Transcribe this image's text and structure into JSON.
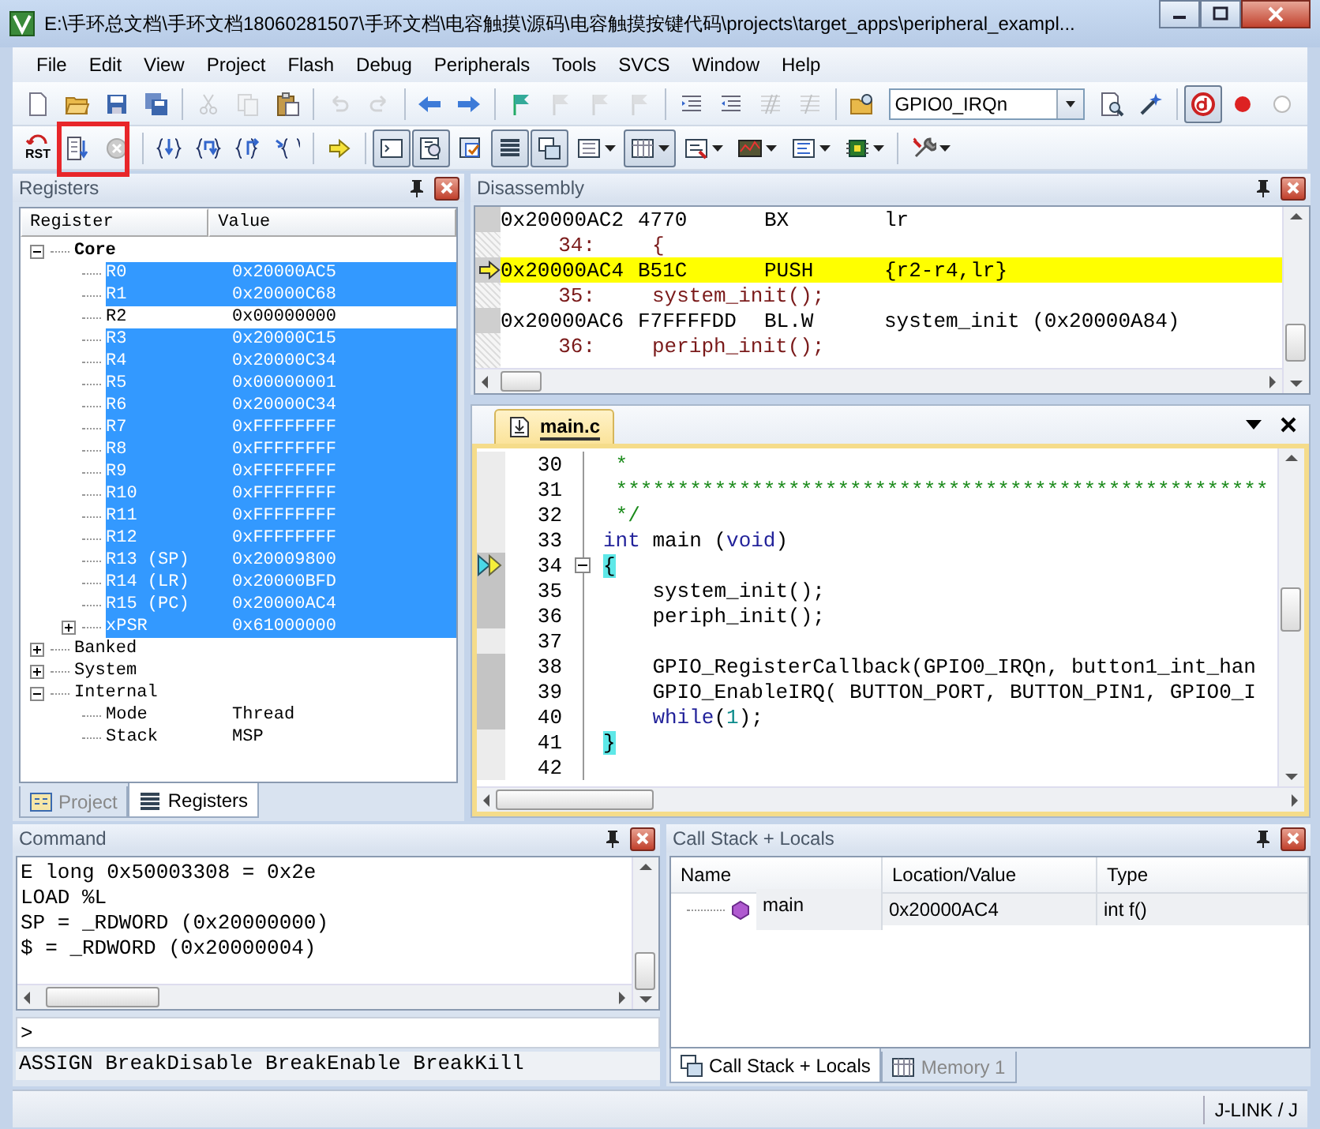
{
  "window": {
    "title": "E:\\手环总文档\\手环文档18060281507\\手环文档\\电容触摸\\源码\\电容触摸按键代码\\projects\\target_apps\\peripheral_exampl..."
  },
  "menu": [
    "File",
    "Edit",
    "View",
    "Project",
    "Flash",
    "Debug",
    "Peripherals",
    "Tools",
    "SVCS",
    "Window",
    "Help"
  ],
  "toolbar": [
    {
      "kind": "new",
      "pressed": false,
      "disabled": false
    },
    {
      "kind": "open",
      "pressed": false,
      "disabled": false
    },
    {
      "kind": "save",
      "pressed": false,
      "disabled": false
    },
    {
      "kind": "save_all",
      "pressed": false,
      "disabled": false
    },
    {
      "kind": "separator"
    },
    {
      "kind": "cut",
      "pressed": false,
      "disabled": true
    },
    {
      "kind": "copy",
      "pressed": false,
      "disabled": true
    },
    {
      "kind": "paste",
      "pressed": false,
      "disabled": false
    },
    {
      "kind": "separator"
    },
    {
      "kind": "undo",
      "pressed": false,
      "disabled": true
    },
    {
      "kind": "redo",
      "pressed": false,
      "disabled": true
    },
    {
      "kind": "separator"
    },
    {
      "kind": "back",
      "pressed": false,
      "disabled": false
    },
    {
      "kind": "forward",
      "pressed": false,
      "disabled": false
    },
    {
      "kind": "separator"
    },
    {
      "kind": "bookmark_set",
      "pressed": false,
      "disabled": false
    },
    {
      "kind": "bookmark_prev",
      "pressed": false,
      "disabled": true
    },
    {
      "kind": "bookmark_next",
      "pressed": false,
      "disabled": true
    },
    {
      "kind": "bookmark_clear",
      "pressed": false,
      "disabled": true
    },
    {
      "kind": "separator"
    },
    {
      "kind": "indent",
      "pressed": false,
      "disabled": false
    },
    {
      "kind": "unindent",
      "pressed": false,
      "disabled": false
    },
    {
      "kind": "comment",
      "pressed": false,
      "disabled": true
    },
    {
      "kind": "uncomment",
      "pressed": false,
      "disabled": true
    },
    {
      "kind": "separator"
    },
    {
      "kind": "find_in_files",
      "pressed": false,
      "disabled": false
    },
    {
      "kind": "combo",
      "value": "GPIO0_IRQn"
    },
    {
      "kind": "find",
      "pressed": false,
      "disabled": false
    },
    {
      "kind": "incremental_find",
      "pressed": false,
      "disabled": false
    },
    {
      "kind": "separator"
    },
    {
      "kind": "debug",
      "pressed": true,
      "disabled": false
    },
    {
      "kind": "breakpoint",
      "pressed": false,
      "disabled": false
    },
    {
      "kind": "breakpoint_off",
      "pressed": false,
      "disabled": false
    }
  ],
  "debug_toolbar": [
    {
      "kind": "reset",
      "label": "RST",
      "pressed": false,
      "dropdown": false
    },
    {
      "kind": "run",
      "pressed": false,
      "dropdown": false
    },
    {
      "kind": "stop",
      "pressed": false,
      "dropdown": false
    },
    {
      "kind": "separator"
    },
    {
      "kind": "step_in",
      "pressed": false,
      "dropdown": false
    },
    {
      "kind": "step_over",
      "pressed": false,
      "dropdown": false
    },
    {
      "kind": "step_out",
      "pressed": false,
      "dropdown": false
    },
    {
      "kind": "run_to_cursor",
      "pressed": false,
      "dropdown": false
    },
    {
      "kind": "separator"
    },
    {
      "kind": "show_next",
      "pressed": false,
      "dropdown": false
    },
    {
      "kind": "separator"
    },
    {
      "kind": "command_window",
      "pressed": true,
      "dropdown": false
    },
    {
      "kind": "disassembly_window",
      "pressed": true,
      "dropdown": false
    },
    {
      "kind": "symbols_window",
      "pressed": false,
      "dropdown": false
    },
    {
      "kind": "registers_window",
      "pressed": true,
      "dropdown": false
    },
    {
      "kind": "call_stack_window",
      "pressed": true,
      "dropdown": false
    },
    {
      "kind": "watch_window",
      "pressed": false,
      "dropdown": true
    },
    {
      "kind": "memory_window",
      "pressed": true,
      "dropdown": true
    },
    {
      "kind": "serial_window",
      "pressed": false,
      "dropdown": true
    },
    {
      "kind": "analysis_window",
      "pressed": false,
      "dropdown": true
    },
    {
      "kind": "trace_window",
      "pressed": false,
      "dropdown": true
    },
    {
      "kind": "system_viewer",
      "pressed": false,
      "dropdown": true
    },
    {
      "kind": "separator"
    },
    {
      "kind": "toolbox",
      "pressed": false,
      "dropdown": true
    }
  ],
  "registers": {
    "title": "Registers",
    "columns": [
      "Register",
      "Value"
    ],
    "tree": [
      {
        "name": "Core",
        "bold": true,
        "expanded": true,
        "selected": false,
        "children": [
          {
            "name": "R0",
            "value": "0x20000AC5",
            "selected": true
          },
          {
            "name": "R1",
            "value": "0x20000C68",
            "selected": true
          },
          {
            "name": "R2",
            "value": "0x00000000",
            "selected": false
          },
          {
            "name": "R3",
            "value": "0x20000C15",
            "selected": true
          },
          {
            "name": "R4",
            "value": "0x20000C34",
            "selected": true
          },
          {
            "name": "R5",
            "value": "0x00000001",
            "selected": true
          },
          {
            "name": "R6",
            "value": "0x20000C34",
            "selected": true
          },
          {
            "name": "R7",
            "value": "0xFFFFFFFF",
            "selected": true
          },
          {
            "name": "R8",
            "value": "0xFFFFFFFF",
            "selected": true
          },
          {
            "name": "R9",
            "value": "0xFFFFFFFF",
            "selected": true
          },
          {
            "name": "R10",
            "value": "0xFFFFFFFF",
            "selected": true
          },
          {
            "name": "R11",
            "value": "0xFFFFFFFF",
            "selected": true
          },
          {
            "name": "R12",
            "value": "0xFFFFFFFF",
            "selected": true
          },
          {
            "name": "R13 (SP)",
            "value": "0x20009800",
            "selected": true
          },
          {
            "name": "R14 (LR)",
            "value": "0x20000BFD",
            "selected": true
          },
          {
            "name": "R15 (PC)",
            "value": "0x20000AC4",
            "selected": true
          },
          {
            "name": "xPSR",
            "value": "0x61000000",
            "selected": true,
            "expanded": false
          }
        ]
      },
      {
        "name": "Banked",
        "bold": false,
        "expanded": false,
        "selected": false
      },
      {
        "name": "System",
        "bold": false,
        "expanded": false,
        "selected": false
      },
      {
        "name": "Internal",
        "bold": false,
        "expanded": true,
        "selected": false,
        "children": [
          {
            "name": "Mode",
            "value": "Thread",
            "selected": false
          },
          {
            "name": "Stack",
            "value": "MSP",
            "selected": false
          }
        ]
      }
    ],
    "tabs": [
      {
        "label": "Project",
        "selected": false
      },
      {
        "label": "Registers",
        "selected": true
      }
    ]
  },
  "disassembly": {
    "title": "Disassembly",
    "lines": [
      {
        "kind": "asm",
        "address": "0x20000AC2",
        "opcode": "4770",
        "mnemonic": "BX",
        "operand": "lr",
        "current": false
      },
      {
        "kind": "source",
        "line": "34:",
        "code": "{"
      },
      {
        "kind": "asm",
        "address": "0x20000AC4",
        "opcode": "B51C",
        "mnemonic": "PUSH",
        "operand": "{r2-r4,lr}",
        "current": true
      },
      {
        "kind": "source",
        "line": "35:",
        "code": "system_init();"
      },
      {
        "kind": "asm",
        "address": "0x20000AC6",
        "opcode": "F7FFFFDD",
        "mnemonic": "BL.W",
        "operand": "system_init (0x20000A84)",
        "current": false
      },
      {
        "kind": "source",
        "line": "36:",
        "code": "periph_init();"
      }
    ]
  },
  "editor": {
    "tabs": [
      {
        "label": "main.c",
        "selected": true
      }
    ],
    "lines": [
      {
        "number": "30",
        "executed": false,
        "current": false,
        "fold_start": false,
        "segments": [
          {
            "kind": "comment",
            "text": " *"
          }
        ]
      },
      {
        "number": "31",
        "executed": false,
        "current": false,
        "fold_start": false,
        "segments": [
          {
            "kind": "comment",
            "text": " *****************************************************"
          }
        ]
      },
      {
        "number": "32",
        "executed": false,
        "current": false,
        "fold_start": false,
        "segments": [
          {
            "kind": "comment",
            "text": " */"
          }
        ]
      },
      {
        "number": "33",
        "executed": false,
        "current": false,
        "fold_start": false,
        "segments": [
          {
            "kind": "keyword",
            "text": "int"
          },
          {
            "kind": "plain",
            "text": " main ("
          },
          {
            "kind": "keyword",
            "text": "void"
          },
          {
            "kind": "plain",
            "text": ")"
          }
        ]
      },
      {
        "number": "34",
        "executed": true,
        "current": true,
        "fold_start": true,
        "segments": [
          {
            "kind": "brace",
            "text": "{"
          }
        ]
      },
      {
        "number": "35",
        "executed": true,
        "current": false,
        "fold_start": false,
        "segments": [
          {
            "kind": "plain",
            "text": "    system_init();"
          }
        ]
      },
      {
        "number": "36",
        "executed": true,
        "current": false,
        "fold_start": false,
        "segments": [
          {
            "kind": "plain",
            "text": "    periph_init();"
          }
        ]
      },
      {
        "number": "37",
        "executed": false,
        "current": false,
        "fold_start": false
      },
      {
        "number": "38",
        "executed": true,
        "current": false,
        "fold_start": false,
        "segments": [
          {
            "kind": "plain",
            "text": "    GPIO_RegisterCallback(GPIO0_IRQn, button1_int_han"
          }
        ]
      },
      {
        "number": "39",
        "executed": true,
        "current": false,
        "fold_start": false,
        "segments": [
          {
            "kind": "plain",
            "text": "    GPIO_EnableIRQ( BUTTON_PORT, BUTTON_PIN1, GPIO0_I"
          }
        ]
      },
      {
        "number": "40",
        "executed": true,
        "current": false,
        "fold_start": false,
        "segments": [
          {
            "kind": "keyword",
            "text": "    while"
          },
          {
            "kind": "plain",
            "text": "("
          },
          {
            "kind": "number",
            "text": "1"
          },
          {
            "kind": "plain",
            "text": ");"
          }
        ]
      },
      {
        "number": "41",
        "executed": false,
        "current": false,
        "fold_start": false,
        "segments": [
          {
            "kind": "brace",
            "text": "}"
          }
        ]
      },
      {
        "number": "42",
        "executed": false,
        "current": false,
        "fold_start": false
      }
    ]
  },
  "command": {
    "title": "Command",
    "lines": [
      "E long 0x50003308 = 0x2e",
      "LOAD %L",
      "SP = _RDWORD (0x20000000)",
      "$ = _RDWORD (0x20000004)"
    ],
    "prompt": ">",
    "hint": "ASSIGN BreakDisable BreakEnable BreakKill"
  },
  "call_stack": {
    "title": "Call Stack + Locals",
    "columns": [
      "Name",
      "Location/Value",
      "Type"
    ],
    "rows": [
      {
        "name": "main",
        "location": "0x20000AC4",
        "type": "int f()"
      }
    ],
    "tabs": [
      {
        "label": "Call Stack + Locals",
        "selected": true
      },
      {
        "label": "Memory 1",
        "selected": false
      }
    ]
  },
  "status_bar": {
    "text": "J-LINK / J"
  }
}
